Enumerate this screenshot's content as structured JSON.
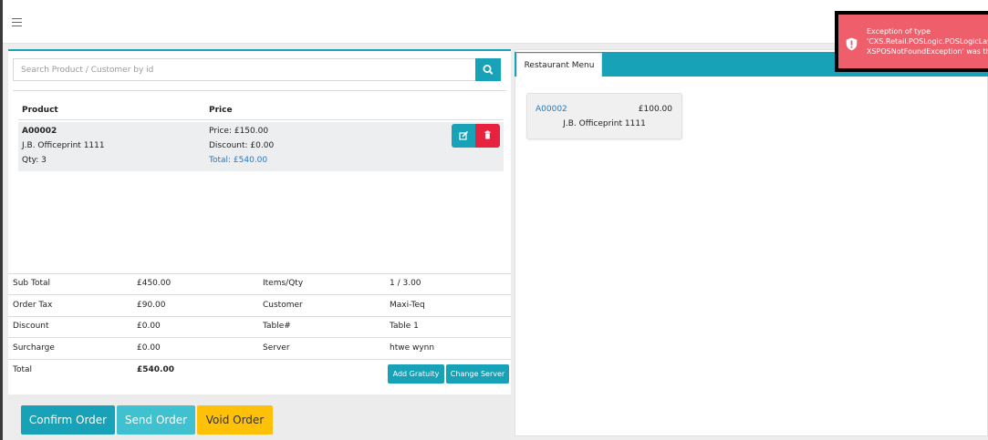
{
  "search": {
    "placeholder": "Search Product / Customer by id"
  },
  "order_table": {
    "headers": {
      "product": "Product",
      "price": "Price"
    },
    "items": [
      {
        "code": "A00002",
        "name": "J.B. Officeprint 1111",
        "qty": "Qty: 3",
        "price": "Price: £150.00",
        "discount": "Discount: £0.00",
        "total": "Total: £540.00"
      }
    ]
  },
  "summary": {
    "rows": [
      {
        "label": "Sub Total",
        "value": "£450.00",
        "label2": "Items/Qty",
        "value2": "1 / 3.00"
      },
      {
        "label": "Order Tax",
        "value": "£90.00",
        "label2": "Customer",
        "value2": "Maxi-Teq"
      },
      {
        "label": "Discount",
        "value": "£0.00",
        "label2": "Table#",
        "value2": "Table 1"
      },
      {
        "label": "Surcharge",
        "value": "£0.00",
        "label2": "Server",
        "value2": "htwe wynn"
      }
    ],
    "total_label": "Total",
    "total_value": "£540.00",
    "add_gratuity_label": "Add Gratuity",
    "change_server_label": "Change Server"
  },
  "actions": {
    "confirm_label": "Confirm Order",
    "send_label": "Send Order",
    "void_label": "Void Order"
  },
  "menu": {
    "tab_label": "Restaurant Menu",
    "items": [
      {
        "code": "A00002",
        "price": "£100.00",
        "name": "J.B. Officeprint 1111"
      }
    ]
  },
  "toast": {
    "lines": [
      "Exception of type",
      "'CXS.Retail.POSLogic.POSLogicLay",
      "XSPOSNotFoundException' was thr"
    ]
  },
  "colors": {
    "accent": "#17a2b8",
    "danger": "#e8213e",
    "info_light": "#3fc1d0",
    "warning": "#ffc107",
    "toast": "#ee5f6b",
    "link": "#1f7ac8"
  },
  "icons": {
    "menu": "hamburger-icon",
    "search": "search-icon",
    "edit": "edit-icon",
    "delete": "trash-icon",
    "alert": "exclamation-shield-icon"
  }
}
